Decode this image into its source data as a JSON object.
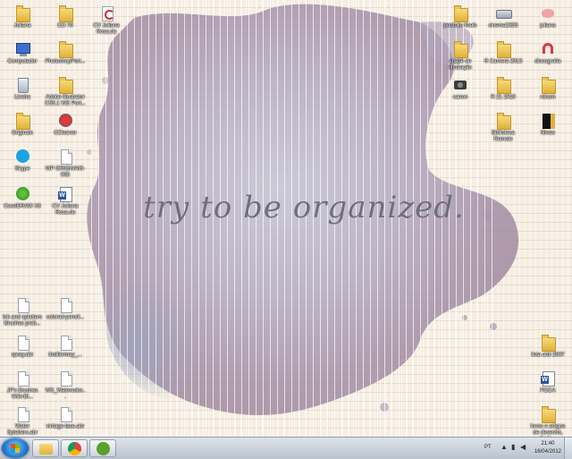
{
  "wallpaper": {
    "tagline": "try to be organized."
  },
  "icons_left": [
    {
      "label": "Juliana",
      "icon": "user-folder-icon"
    },
    {
      "label": "Computador",
      "icon": "computer-icon"
    },
    {
      "label": "Lixeira",
      "icon": "recycle-bin-icon"
    },
    {
      "label": "Originais",
      "icon": "folder-icon"
    },
    {
      "label": "Skype",
      "icon": "skype-icon"
    },
    {
      "label": "CorelDRAW X6",
      "icon": "coreldraw-icon"
    },
    {
      "label": "Ink and splatters Brushes prob...",
      "icon": "file-icon"
    },
    {
      "label": "spray.abr",
      "icon": "file-icon"
    },
    {
      "label": "JP's Brushes Wiki-Bl...",
      "icon": "file-icon"
    },
    {
      "label": "Water Splatters.abr",
      "icon": "file-icon"
    }
  ],
  "icons_left2": [
    {
      "label": "CO 70",
      "icon": "folder-icon"
    },
    {
      "label": "PhotoshopPort...",
      "icon": "folder-icon"
    },
    {
      "label": "Adobe Illustrator CS5.1 WE Port...",
      "icon": "folder-icon"
    },
    {
      "label": "CCleaner",
      "icon": "ccleaner-icon"
    },
    {
      "label": "WP ORIGINAIS-005",
      "icon": "file-icon"
    },
    {
      "label": "CV Juliana Rosa.do",
      "icon": "word-doc-icon"
    },
    {
      "label": "colored-pencil...",
      "icon": "file-icon"
    },
    {
      "label": "tholliermay_...",
      "icon": "file-icon"
    },
    {
      "label": "WS_Watercolor...",
      "icon": "file-icon"
    },
    {
      "label": "vintage-lace.abr",
      "icon": "file-icon"
    }
  ],
  "icons_top3": [
    {
      "label": "CV Juliana Rosa.do",
      "icon": "pdf-icon"
    }
  ],
  "icons_right": [
    {
      "label": "portfolio finals",
      "icon": "folder-icon"
    },
    {
      "label": "cinema2333",
      "icon": "drive-icon"
    },
    {
      "label": "juliana",
      "icon": "piggy-icon"
    },
    {
      "label": "shape de ilustração",
      "icon": "folder-icon"
    },
    {
      "label": "R Camera 2013",
      "icon": "folder-icon"
    },
    {
      "label": "discografia",
      "icon": "headphones-icon"
    },
    {
      "label": "canon",
      "icon": "camera-icon"
    },
    {
      "label": "R 21 2010",
      "icon": "folder-icon"
    },
    {
      "label": "rdsom",
      "icon": "folder-icon"
    },
    {
      "label": "Biblioteca Remote",
      "icon": "folder-icon"
    },
    {
      "label": "filmes",
      "icon": "black-folder-icon"
    },
    {
      "label": "lista anti 2007",
      "icon": "folder-icon"
    },
    {
      "label": "POCA",
      "icon": "word-doc-icon"
    },
    {
      "label": "livros e artigos de desenho, Ilustr...",
      "icon": "folder-icon"
    }
  ],
  "taskbar": {
    "pinned": [
      {
        "name": "explorer",
        "icon": "folder-icon"
      },
      {
        "name": "chrome",
        "icon": "chrome-icon"
      },
      {
        "name": "utorrent",
        "icon": "utorrent-icon"
      }
    ],
    "language": "PT",
    "time": "21:40",
    "date": "16/04/2012"
  }
}
